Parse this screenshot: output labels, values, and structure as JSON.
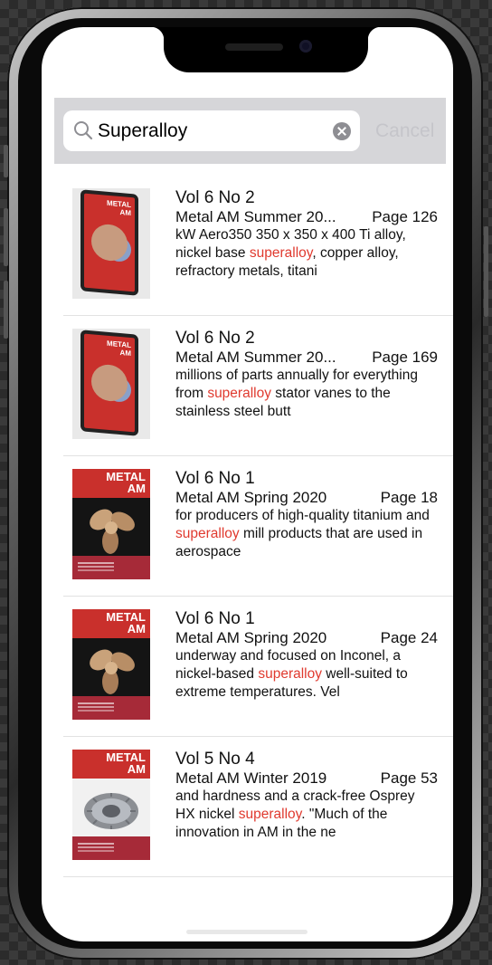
{
  "search": {
    "query": "Superalloy",
    "cancel_label": "Cancel"
  },
  "cover": {
    "title_line1": "METAL",
    "title_line2": "AM"
  },
  "results": [
    {
      "issue": "Vol 6 No 2",
      "magazine": "Metal AM Summer 20...",
      "page": "Page 126",
      "excerpt_before": "kW Aero350 350 x 350 x 400 Ti alloy, nickel base ",
      "highlight": "superalloy",
      "excerpt_after": ", copper alloy, refractory metals, titani"
    },
    {
      "issue": "Vol 6 No 2",
      "magazine": "Metal AM Summer 20...",
      "page": "Page 169",
      "excerpt_before": "millions of parts annually for everything from ",
      "highlight": "superalloy",
      "excerpt_after": " stator vanes to the stainless steel butt"
    },
    {
      "issue": "Vol 6 No 1",
      "magazine": "Metal AM Spring 2020",
      "page": "Page 18",
      "excerpt_before": "for producers of high-quality titanium and ",
      "highlight": "superalloy",
      "excerpt_after": " mill products that are used in aerospace"
    },
    {
      "issue": "Vol 6 No 1",
      "magazine": "Metal AM Spring 2020",
      "page": "Page 24",
      "excerpt_before": "underway and focused on Inconel, a nickel-based ",
      "highlight": "superalloy",
      "excerpt_after": " well-suited to extreme temperatures. Vel"
    },
    {
      "issue": "Vol 5 No 4",
      "magazine": "Metal AM Winter 2019",
      "page": "Page 53",
      "excerpt_before": "and hardness and a crack-free Osprey HX nickel ",
      "highlight": "superalloy",
      "excerpt_after": ". \"Much of the innovation in AM in the ne"
    }
  ],
  "colors": {
    "highlight": "#e03a2f",
    "cover_red": "#c9302c",
    "search_bar_bg": "#d6d6d9"
  }
}
